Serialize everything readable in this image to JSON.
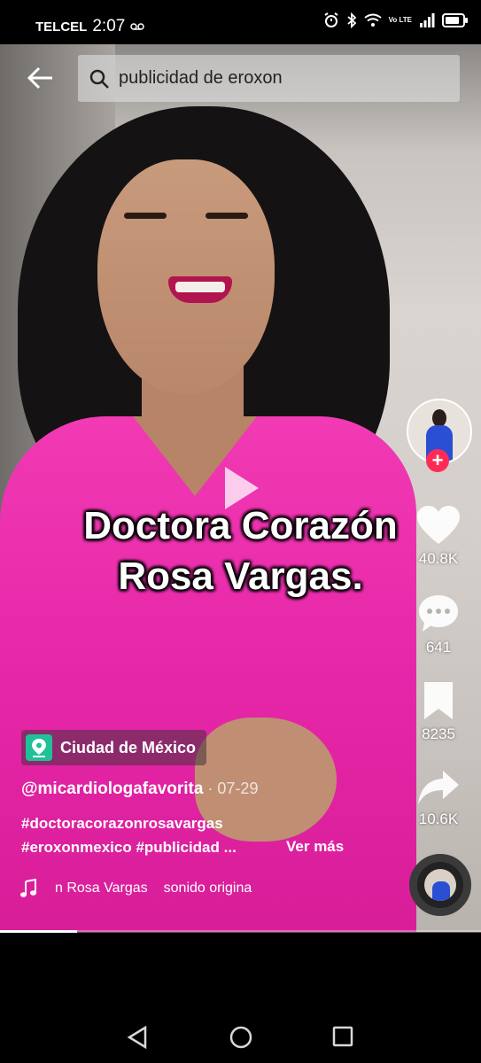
{
  "status_bar": {
    "carrier": "TELCEL",
    "time": "2:07",
    "network_label": "Vo LTE"
  },
  "search": {
    "query": "publicidad de eroxon"
  },
  "video": {
    "caption_line1": "Doctora Corazón",
    "caption_line2": "Rosa Vargas.",
    "progress": 0.16
  },
  "actions": {
    "likes": "40.8K",
    "comments": "641",
    "saves": "8235",
    "shares": "10.6K"
  },
  "post": {
    "location": "Ciudad de México",
    "username": "@micardiologafavorita",
    "date": " · 07-29",
    "hashtags_line1": "#doctoracorazonrosavargas",
    "hashtags_line2": "#eroxonmexico #publicidad ...",
    "see_more": "Ver más",
    "music_artist": "n Rosa Vargas",
    "music_title": "sonido origina"
  },
  "colors": {
    "follow_red": "#fe2c55",
    "location_green": "#20c197",
    "shirt_pink": "#e626a8"
  },
  "icons": [
    "back-arrow-icon",
    "search-icon",
    "play-icon",
    "heart-icon",
    "comment-icon",
    "bookmark-icon",
    "share-icon",
    "music-note-icon",
    "location-pin-icon"
  ]
}
